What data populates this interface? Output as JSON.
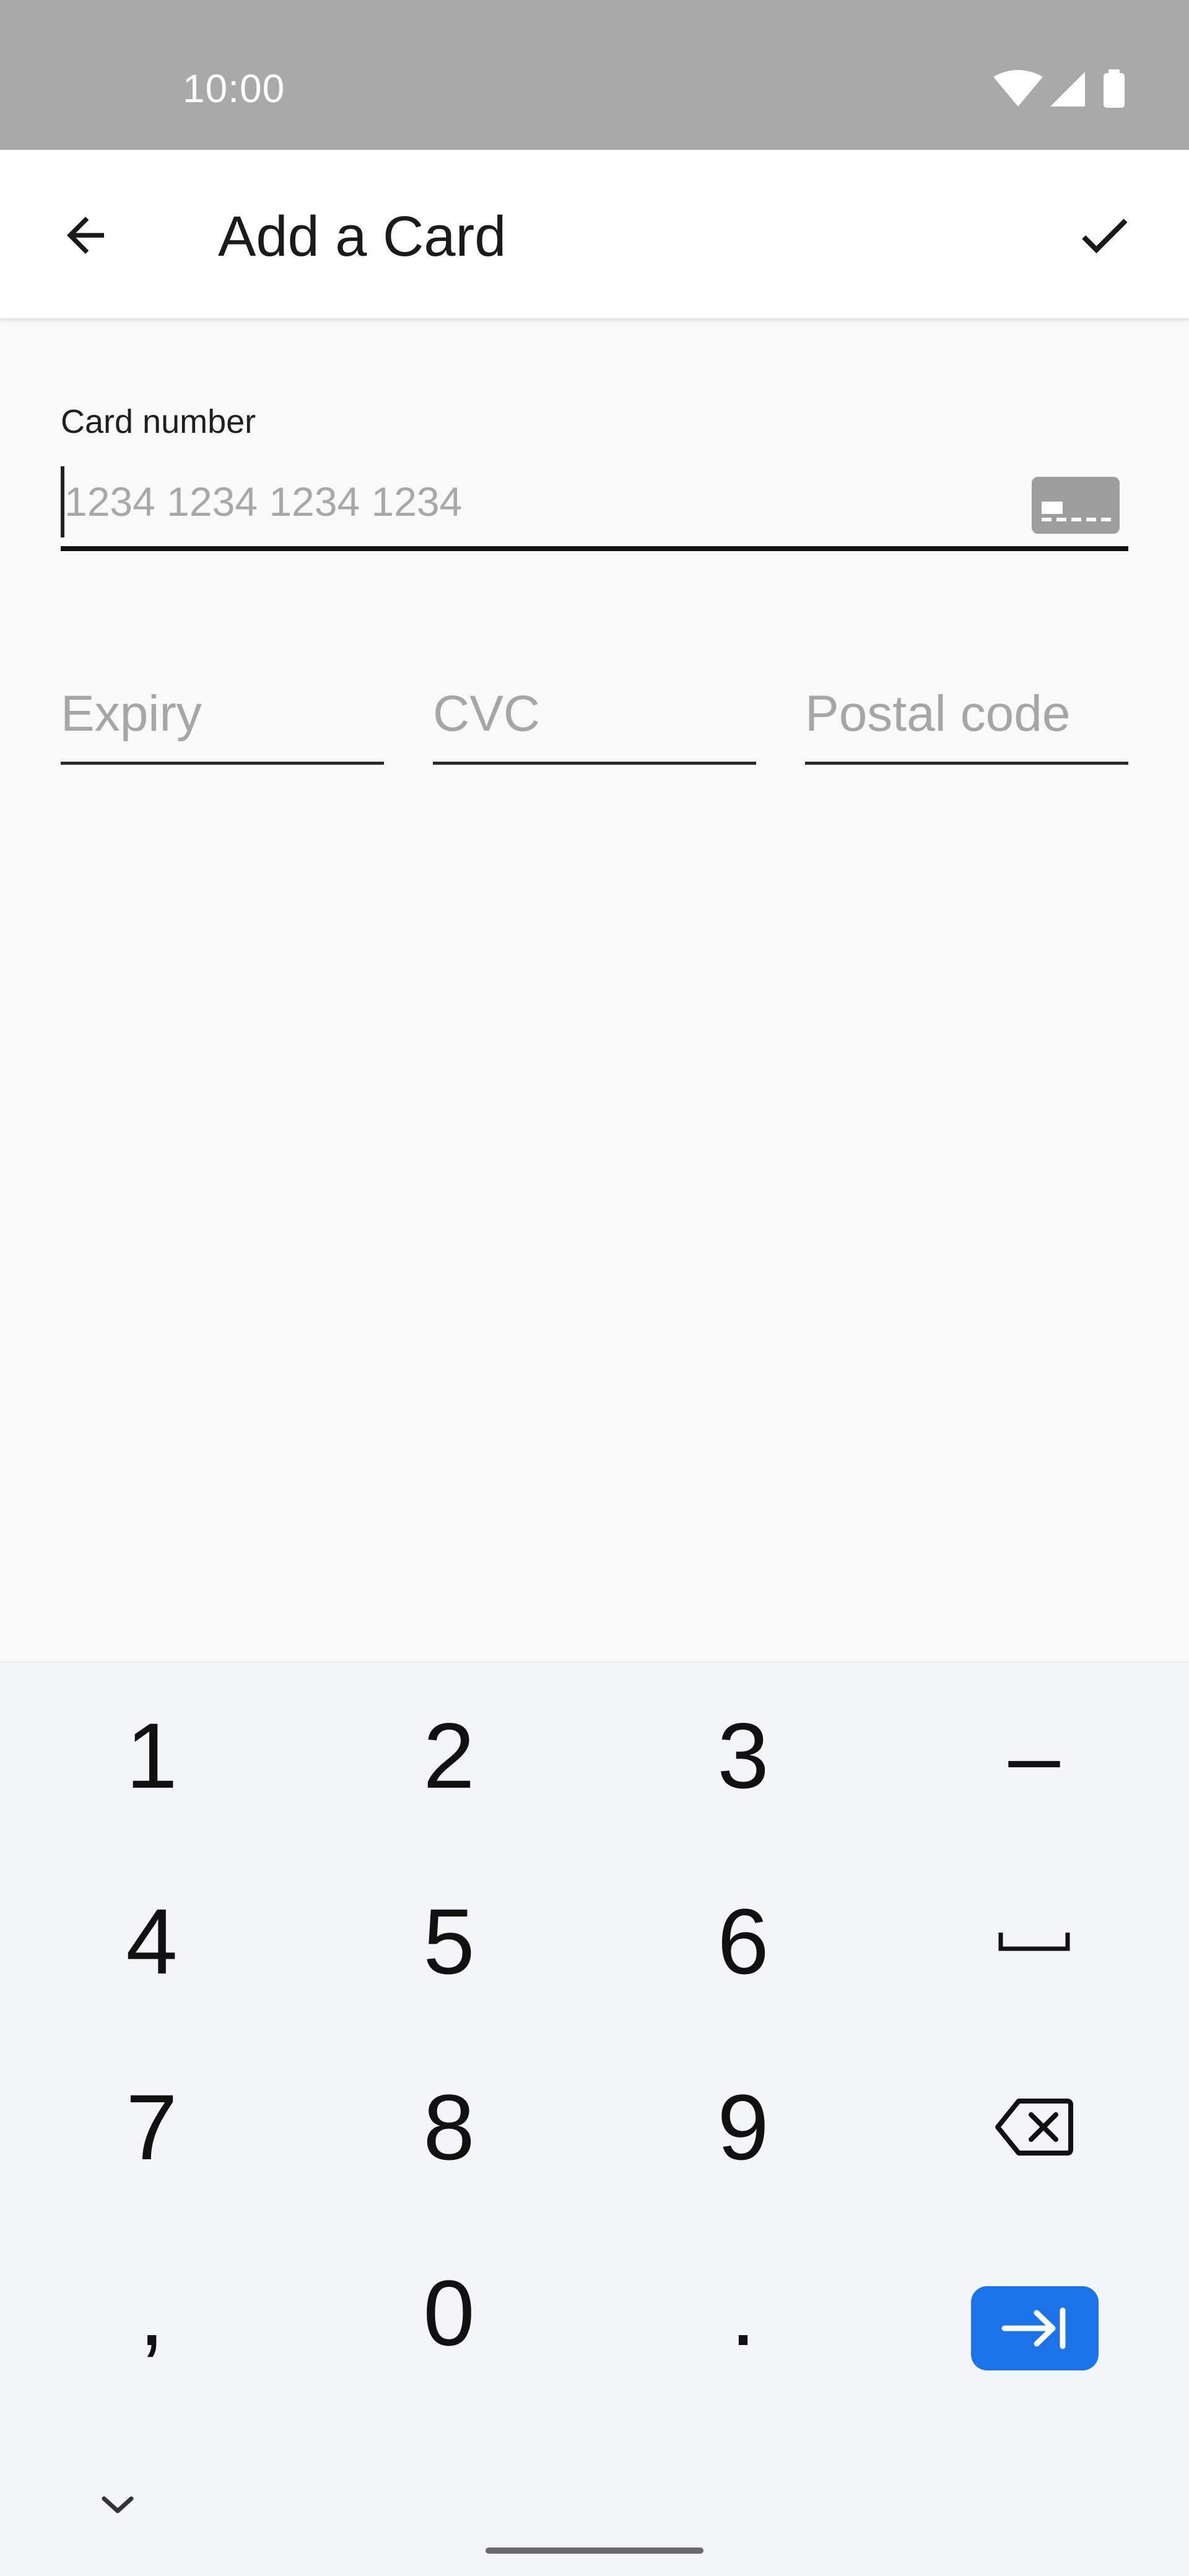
{
  "status_bar": {
    "time": "10:00",
    "icons": [
      "wifi-icon",
      "cellular-signal-icon",
      "battery-icon"
    ]
  },
  "app_bar": {
    "title": "Add a Card",
    "back_icon": "arrow-back-icon",
    "confirm_icon": "check-icon"
  },
  "form": {
    "card_number": {
      "label": "Card number",
      "placeholder": "1234 1234 1234 1234",
      "value": "",
      "icon": "generic-card-icon"
    },
    "expiry": {
      "placeholder": "Expiry",
      "value": ""
    },
    "cvc": {
      "placeholder": "CVC",
      "value": ""
    },
    "postal_code": {
      "placeholder": "Postal code",
      "value": ""
    }
  },
  "keyboard": {
    "rows": [
      [
        "1",
        "2",
        "3",
        "–"
      ],
      [
        "4",
        "5",
        "6",
        "space-icon"
      ],
      [
        "7",
        "8",
        "9",
        "backspace-icon"
      ],
      [
        ",",
        "0",
        ".",
        "next-field-icon"
      ]
    ],
    "collapse_icon": "chevron-down-icon"
  },
  "colors": {
    "status_bar_bg": "#a9a9a9",
    "app_bar_bg": "#ffffff",
    "page_bg": "#f9f9fa",
    "keyboard_bg": "#f4f5f9",
    "accent": "#1a73e8"
  }
}
